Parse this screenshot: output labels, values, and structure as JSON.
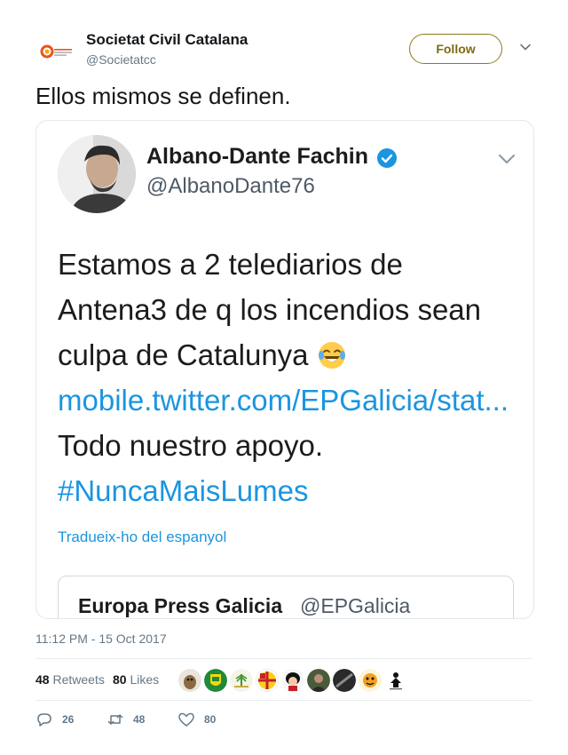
{
  "author": {
    "name": "Societat Civil Catalana",
    "handle": "@Societatcc",
    "avatar_icon": "societat-civil-catalana-logo",
    "follow_label": "Follow"
  },
  "tweet": {
    "text": "Ellos mismos se definen.",
    "timestamp": "11:12 PM - 15 Oct 2017"
  },
  "embedded_image": {
    "name": "Albano-Dante Fachin",
    "handle": "@AlbanoDante76",
    "verified": true,
    "body_lines": [
      "Estamos a 2 telediarios de",
      "Antena3 de q los incendios sean",
      "culpa de Catalunya"
    ],
    "link": "mobile.twitter.com/EPGalicia/stat...",
    "support_line": "Todo nuestro apoyo.",
    "hashtag": "#NuncaMaisLumes",
    "translate_label": "Tradueix-ho del espanyol",
    "quoted": {
      "name": "Europa Press Galicia",
      "handle": "@EPGalicia"
    }
  },
  "stats": {
    "retweets_count": "48",
    "retweets_label": "Retweets",
    "likes_count": "80",
    "likes_label": "Likes",
    "likers_count": 9
  },
  "actions": {
    "reply_count": "26",
    "retweet_count": "48",
    "like_count": "80"
  },
  "colors": {
    "link_blue": "#1b95e0",
    "follow_accent": "#7d6b14",
    "muted": "#657786"
  }
}
